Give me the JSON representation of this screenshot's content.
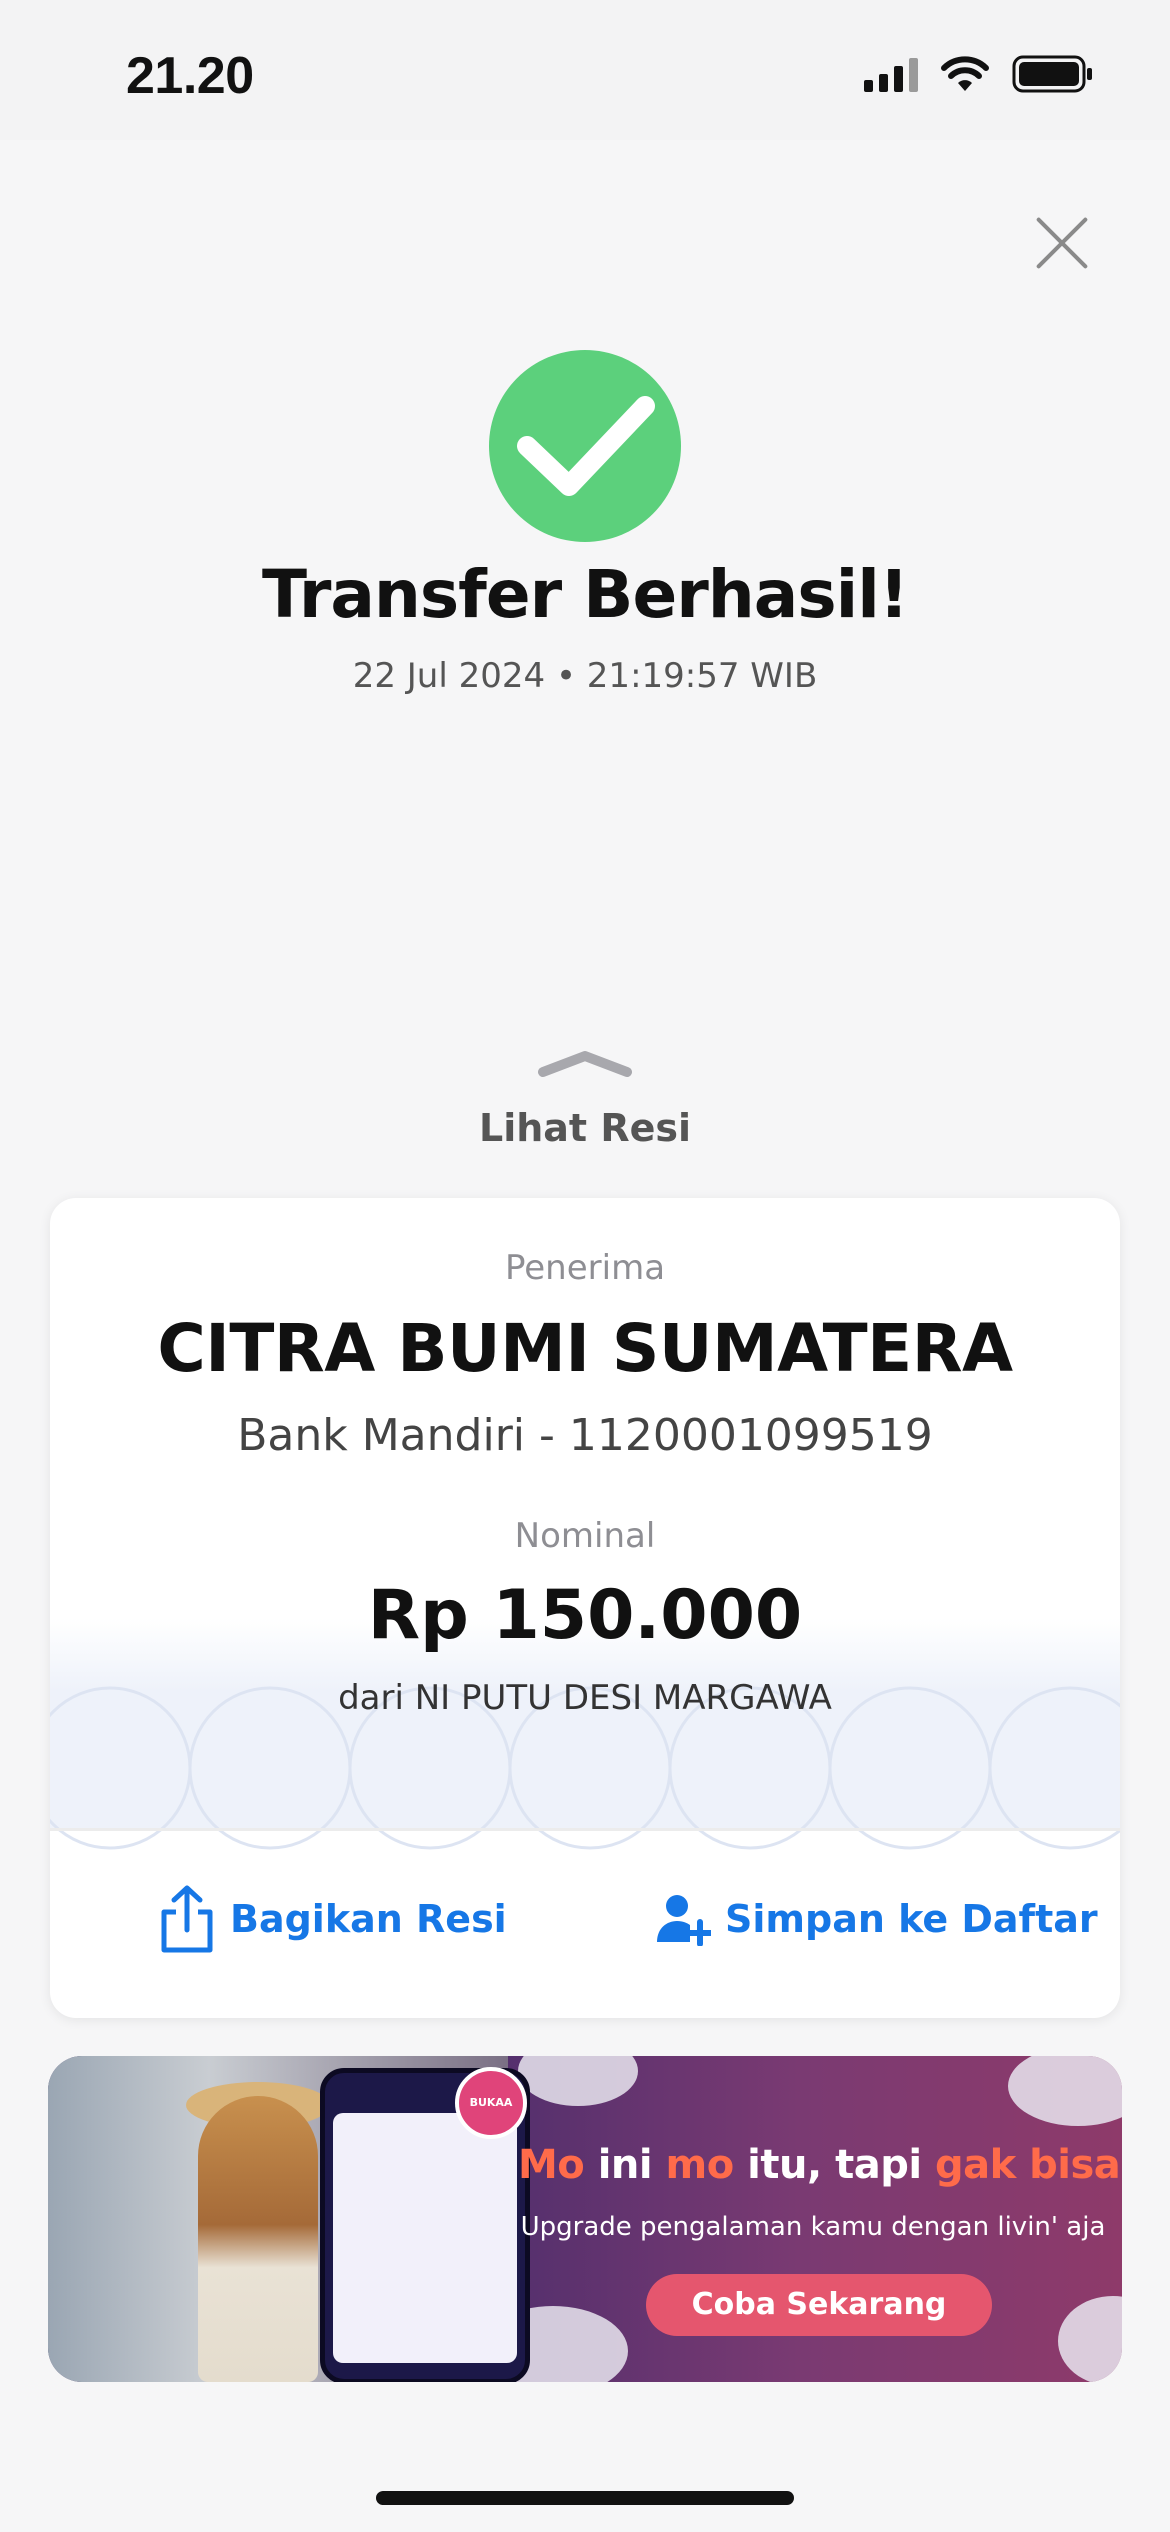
{
  "status_bar": {
    "time": "21.20"
  },
  "header": {
    "title": "Transfer Berhasil!",
    "datetime": "22 Jul 2024 • 21:19:57 WIB"
  },
  "receipt_toggle": {
    "label": "Lihat Resi"
  },
  "receipt": {
    "recipient_label": "Penerima",
    "recipient_name": "CITRA BUMI SUMATERA",
    "recipient_bank": "Bank Mandiri - 1120001099519",
    "amount_label": "Nominal",
    "amount": "Rp 150.000",
    "sender": "dari NI PUTU DESI MARGAWA",
    "share_label": "Bagikan Resi",
    "save_label": "Simpan ke Daftar"
  },
  "banner": {
    "headline_parts": [
      "Mo",
      " ini ",
      "mo",
      " itu, tapi ",
      "gak bisa",
      "?"
    ],
    "subtext": "Upgrade pengalaman kamu dengan livin' aja",
    "button_label": "Coba Sekarang",
    "phone_badge": "BUKAA"
  },
  "colors": {
    "success": "#5cd07c",
    "accent": "#1677e6",
    "banner_button": "#e5566e",
    "banner_highlight": "#ff6b4a"
  },
  "icons": [
    "signal-icon",
    "wifi-icon",
    "battery-icon",
    "close-icon",
    "check-icon",
    "chevron-up-icon",
    "share-icon",
    "add-user-icon"
  ]
}
